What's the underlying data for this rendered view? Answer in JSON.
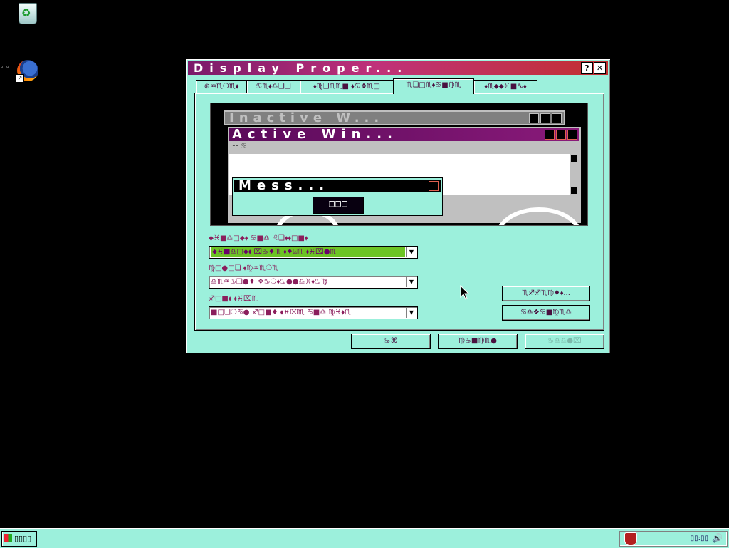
{
  "desktop": {
    "icons": [
      {
        "name": "recycle-bin",
        "label": ""
      },
      {
        "name": "firefox-shortcut",
        "label": ""
      }
    ],
    "edge_text": "◦ ◦"
  },
  "dialog": {
    "title": "Display Proper...",
    "help_button": "?",
    "close_button": "✕",
    "tabs": [
      {
        "label": "⊕♒♏❍♏⬧"
      },
      {
        "label": "♋♏⬧♎❏❏"
      },
      {
        "label": "⬧♍❑♏♏■ ⬧♋❖♏□"
      },
      {
        "label": "♏❏□♏⬧♋■♍♏"
      },
      {
        "label": "⬧♏⬥⬥♓■♑⬧"
      }
    ],
    "active_tab_index": 3,
    "preview": {
      "inactive_title": "Inactive W...",
      "active_title": "Active Win...",
      "menu_text": "⚏ ♋",
      "message_title": "Mess...",
      "ok_text": "❒❒❒"
    },
    "fields": [
      {
        "label": "⬥♓■♎□⬥⬧ ♋■♎ ♌❑⬧⬧□■⬧",
        "value": "⬥♓■♎□⬥⬧ ⌧♋♦♏ ⬧♦⍓♏ ⬧♓⌧●♏",
        "selected": true
      },
      {
        "label": "♍□●□❏ ⬧♍♒♏❍♏",
        "value": "♎♏♒♋❑●♦ ❖♋❍⬧♋●●♎♓⬧♋♍",
        "selected": false
      },
      {
        "label": "♐□■⬧ ⬧♓⌧♏",
        "value": "■□❏❍♋● ♐□■♦ ⬧♓⌧♏ ♋■♎ ♍♓⬧♏",
        "selected": false
      }
    ],
    "effects_button": "♏♐♐♏♍♦⬧...",
    "advanced_button": "♋♎❖♋■♍♏♎",
    "ok_button": "♋⌘",
    "cancel_button": "♍♋■♍♏●",
    "apply_button": "♋♎♎●⌧"
  },
  "taskbar": {
    "start_label": "▯▯▯▯",
    "clock": "▯▯:▯▯"
  },
  "colors": {
    "dialog_bg": "#9cf0dc",
    "title_gradient_start": "#7a1a6a",
    "title_gradient_end": "#c23030",
    "selected_combo": "#6cc424",
    "label_color": "#8b1e5c"
  }
}
